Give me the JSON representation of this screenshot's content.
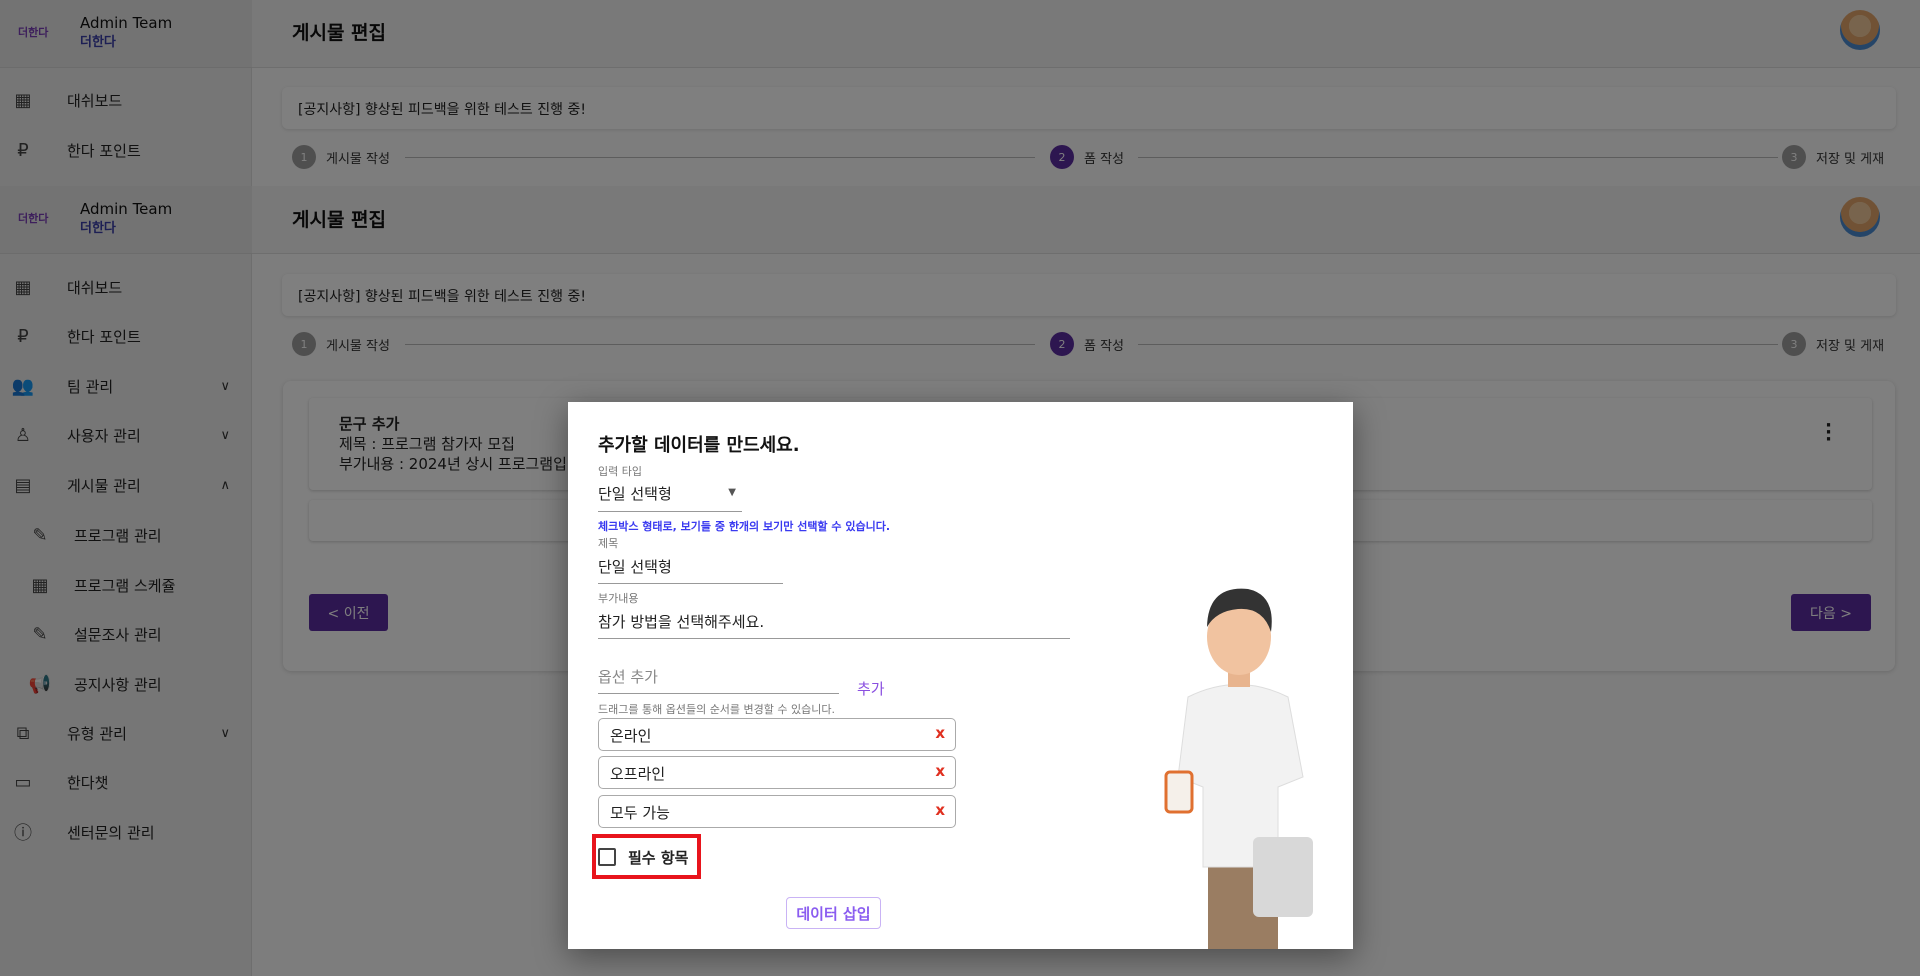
{
  "sidebar": {
    "brand_logo": "더한다",
    "brand_title": "Admin Team",
    "brand_sub": "더한다",
    "items": [
      {
        "label": "대쉬보드",
        "icon": "dashboard-icon"
      },
      {
        "label": "한다 포인트",
        "icon": "ruble-icon"
      },
      {
        "label": "팀 관리",
        "icon": "people-icon",
        "expand": "down"
      },
      {
        "label": "사용자 관리",
        "icon": "person-icon",
        "expand": "down"
      },
      {
        "label": "게시물 관리",
        "icon": "post-add-icon",
        "expand": "up"
      },
      {
        "label": "프로그램 관리",
        "icon": "pencil-icon"
      },
      {
        "label": "프로그램 스케쥴",
        "icon": "calendar-icon"
      },
      {
        "label": "설문조사 관리",
        "icon": "pencil-icon"
      },
      {
        "label": "공지사항 관리",
        "icon": "megaphone-icon"
      },
      {
        "label": "유형 관리",
        "icon": "copy-icon",
        "expand": "down"
      },
      {
        "label": "한다챗",
        "icon": "chat-icon"
      },
      {
        "label": "센터문의 관리",
        "icon": "help-icon"
      }
    ]
  },
  "header": {
    "title": "게시물 편집"
  },
  "notice": "[공지사항] 향상된 피드백을 위한 테스트 진행 중!",
  "stepper": [
    {
      "num": "1",
      "label": "게시물 작성"
    },
    {
      "num": "2",
      "label": "폼 작성",
      "active": true
    },
    {
      "num": "3",
      "label": "저장 및 게재"
    }
  ],
  "form_item": {
    "heading": "문구 추가",
    "title": "제목 : 프로그램 참가자 모집",
    "extra": "부가내용 : 2024년 상시 프로그램입"
  },
  "buttons": {
    "prev": "< 이전",
    "next": "다음 >"
  },
  "modal": {
    "title": "추가할 데이터를 만드세요.",
    "type_label": "입력 타입",
    "type_value": "단일 선택형",
    "type_help": "체크박스 형태로, 보기들 중 한개의 보기만 선택할 수 있습니다.",
    "title_label": "제목",
    "title_value": "단일 선택형",
    "extra_label": "부가내용",
    "extra_value": "참가 방법을 선택해주세요.",
    "option_placeholder": "옵션 추가",
    "add_label": "추가",
    "drag_hint": "드래그를 통해 옵션들의 순서를 변경할 수 있습니다.",
    "options": [
      "온라인",
      "오프라인",
      "모두 가능"
    ],
    "remove_mark": "x",
    "required_label": "필수 항목",
    "required_checked": false,
    "insert_label": "데이터 삽입"
  },
  "colors": {
    "primary": "#5b2ca0",
    "accent": "#8a4fe0",
    "help": "#3a3af0",
    "remove": "#e03020",
    "highlight": "#e8141c"
  }
}
